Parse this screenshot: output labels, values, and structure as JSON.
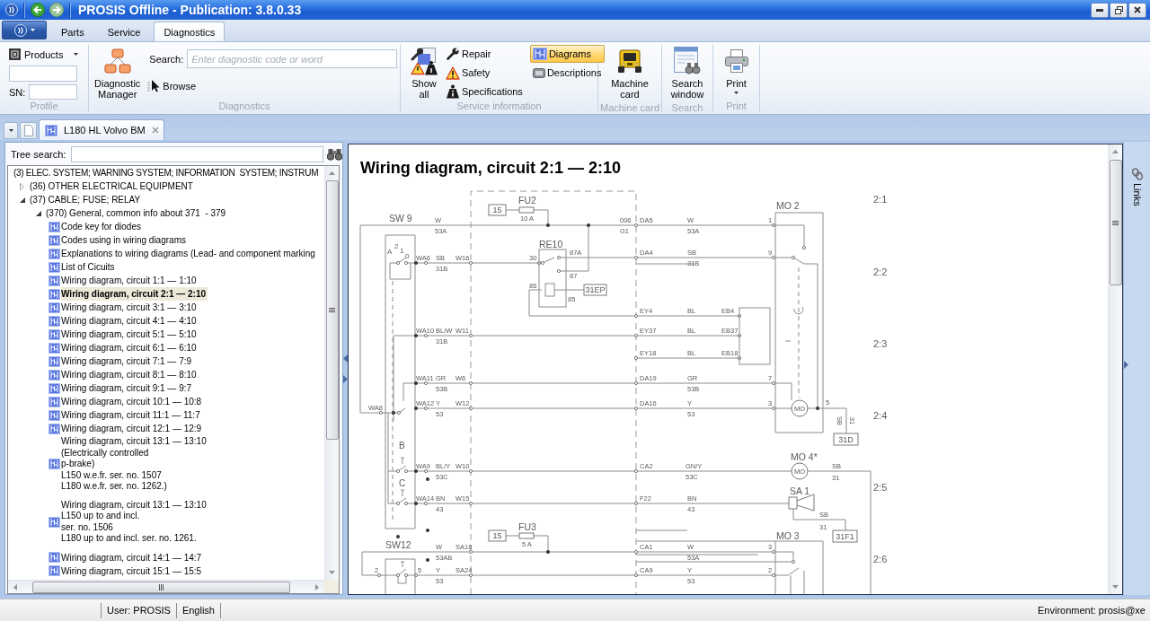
{
  "window": {
    "title": "PROSIS Offline - Publication: 3.8.0.33"
  },
  "ribbon": {
    "tabs": [
      {
        "label": "Parts",
        "selected": false
      },
      {
        "label": "Service",
        "selected": false
      },
      {
        "label": "Diagnostics",
        "selected": true
      }
    ],
    "profile": {
      "products_label": "Products",
      "sn_label": "SN:",
      "group_label": "Profile"
    },
    "diagnostics": {
      "manager_label": "Diagnostic Manager",
      "search_label": "Search:",
      "search_placeholder": "Enter diagnostic code or word",
      "browse_label": "Browse",
      "group_label": "Diagnostics"
    },
    "service_information": {
      "show_all_label": "Show all",
      "info_types": [
        {
          "kind": "repair",
          "label": "Repair",
          "selected": false
        },
        {
          "kind": "safety",
          "label": "Safety",
          "selected": false
        },
        {
          "kind": "specifications",
          "label": "Specifications",
          "selected": false
        }
      ],
      "document_types": [
        {
          "kind": "diagrams",
          "label": "Diagrams",
          "selected": true
        },
        {
          "kind": "descriptions",
          "label": "Descriptions",
          "selected": false
        }
      ],
      "group_label": "Service information"
    },
    "machine_card": {
      "button_label": "Machine card",
      "group_label": "Machine card"
    },
    "search": {
      "button_label": "Search window",
      "group_label": "Search"
    },
    "print": {
      "button_label": "Print",
      "group_label": "Print"
    }
  },
  "document_tabs": [
    {
      "label": "L180 HL Volvo BM",
      "selected": true
    }
  ],
  "tree_panel": {
    "search_label": "Tree search:",
    "items": [
      {
        "label": "(3) ELEC. SYSTEM; WARNING SYSTEM; INFORMATION  SYSTEM; INSTRUM",
        "children": [
          {
            "label": "(36) OTHER ELECTRICAL EQUIPMENT",
            "expanded": false
          },
          {
            "label": "(37) CABLE; FUSE; RELAY",
            "expanded": true,
            "children": [
              {
                "label": "(370) General, common info about 371  - 379",
                "expanded": true,
                "children": [
                  {
                    "label": "Code key for diodes",
                    "selected": false
                  },
                  {
                    "label": "Codes using in wiring diagrams",
                    "selected": false
                  },
                  {
                    "label": "Explanations to wiring diagrams (Lead- and component marking",
                    "selected": false
                  },
                  {
                    "label": "List of Cicuits",
                    "selected": false
                  },
                  {
                    "label": "Wiring diagram, circuit 1:1 — 1:10",
                    "selected": false
                  },
                  {
                    "label": "Wiring diagram, circuit 2:1 — 2:10",
                    "selected": true
                  },
                  {
                    "label": "Wiring diagram, circuit 3:1 — 3:10",
                    "selected": false
                  },
                  {
                    "label": "Wiring diagram, circuit 4:1 — 4:10",
                    "selected": false
                  },
                  {
                    "label": "Wiring diagram, circuit 5:1 — 5:10",
                    "selected": false
                  },
                  {
                    "label": "Wiring diagram, circuit 6:1 — 6:10",
                    "selected": false
                  },
                  {
                    "label": "Wiring diagram, circuit 7:1 — 7:9",
                    "selected": false
                  },
                  {
                    "label": "Wiring diagram, circuit 8:1 — 8:10",
                    "selected": false
                  },
                  {
                    "label": "Wiring diagram, circuit 9:1 — 9:7",
                    "selected": false
                  },
                  {
                    "label": "Wiring diagram, circuit 10:1 — 10:8",
                    "selected": false
                  },
                  {
                    "label": "Wiring diagram, circuit 11:1 — 11:7",
                    "selected": false
                  },
                  {
                    "label": "Wiring diagram, circuit 12:1 — 12:9",
                    "selected": false
                  },
                  {
                    "label": "Wiring diagram, circuit 13:1 — 13:10\n(Electrically controlled\np-brake)\nL150 w.e.fr. ser. no. 1507\nL180 w.e.fr. ser. no. 1262.)",
                    "selected": false
                  },
                  {
                    "label": "Wiring diagram, circuit 13:1 — 13:10\nL150 up to and incl.\nser. no. 1506\nL180 up to and incl. ser. no. 1261.",
                    "selected": false
                  },
                  {
                    "label": "Wiring diagram, circuit 14:1 — 14:7",
                    "selected": false
                  },
                  {
                    "label": "Wiring diagram, circuit 15:1 — 15:5",
                    "selected": false
                  }
                ]
              }
            ]
          }
        ]
      }
    ]
  },
  "document": {
    "title": "Wiring diagram, circuit 2:1 — 2:10",
    "diagram": {
      "sections": [
        "2:1",
        "2:2",
        "2:3",
        "2:4",
        "2:5",
        "2:6"
      ],
      "components": [
        {
          "kind": "switch",
          "label": "SW 9",
          "position_labels": [
            "A",
            "2",
            "1",
            "0",
            "B",
            "C"
          ]
        },
        {
          "kind": "fuse",
          "label": "FU2",
          "rating": "10 A",
          "supply": "15"
        },
        {
          "kind": "relay",
          "label": "RE10",
          "pins": [
            "30",
            "87A",
            "87",
            "86",
            "85"
          ],
          "ground": "31EP"
        },
        {
          "kind": "motor_unit",
          "label": "MO 2",
          "symbol": "MO",
          "pin": "5",
          "ground_wire": [
            "SB",
            "31"
          ],
          "ground": "31D"
        },
        {
          "kind": "motor",
          "label": "MO 4*",
          "symbol": "MO",
          "ground_wire": [
            "SB",
            "31"
          ]
        },
        {
          "kind": "horn",
          "label": "SA 1",
          "ground_wire": [
            "SB",
            "31"
          ],
          "ground": "31F1"
        },
        {
          "kind": "switch",
          "label": "SW12"
        },
        {
          "kind": "fuse",
          "label": "FU3",
          "rating": "5 A",
          "supply": "15"
        },
        {
          "kind": "motor_unit",
          "label": "MO 3"
        }
      ],
      "wires": [
        {
          "labels": [
            "W",
            "53A",
            "006",
            "G1",
            "DA5",
            "W",
            "53A",
            "1"
          ]
        },
        {
          "labels": [
            "WA6",
            "SB",
            "31B",
            "W16"
          ]
        },
        {
          "labels": [
            "DA4",
            "SB",
            "31B",
            "9"
          ]
        },
        {
          "labels": [
            "EY4",
            "BL",
            "EB4"
          ]
        },
        {
          "labels": [
            "WA10",
            "BL/W",
            "31B",
            "W11",
            "EY37",
            "BL",
            "EB37"
          ]
        },
        {
          "labels": [
            "EY18",
            "BL",
            "EB18"
          ]
        },
        {
          "labels": [
            "WA11",
            "GR",
            "53B",
            "W6",
            "DA19",
            "GR",
            "53B",
            "7"
          ]
        },
        {
          "labels": [
            "WA8"
          ]
        },
        {
          "labels": [
            "WA12",
            "Y",
            "53",
            "W12",
            "DA16",
            "Y",
            "53",
            "3"
          ]
        },
        {
          "labels": [
            "WA9",
            "BL/Y",
            "53C",
            "W10",
            "CA2",
            "GN/Y",
            "53C"
          ]
        },
        {
          "labels": [
            "WA14",
            "BN",
            "43",
            "W15",
            "F22",
            "BN",
            "43"
          ]
        },
        {
          "labels": [
            "W",
            "53AB",
            "SA18",
            "CA1",
            "W",
            "53A",
            "3"
          ]
        },
        {
          "labels": [
            "2",
            "5",
            "Y",
            "53",
            "SA24",
            "CA9",
            "Y",
            "53",
            "2"
          ]
        }
      ]
    }
  },
  "links_panel": {
    "label": "Links"
  },
  "status_bar": {
    "user": "User: PROSIS",
    "language": "English",
    "environment": "Environment: prosis@xe"
  }
}
